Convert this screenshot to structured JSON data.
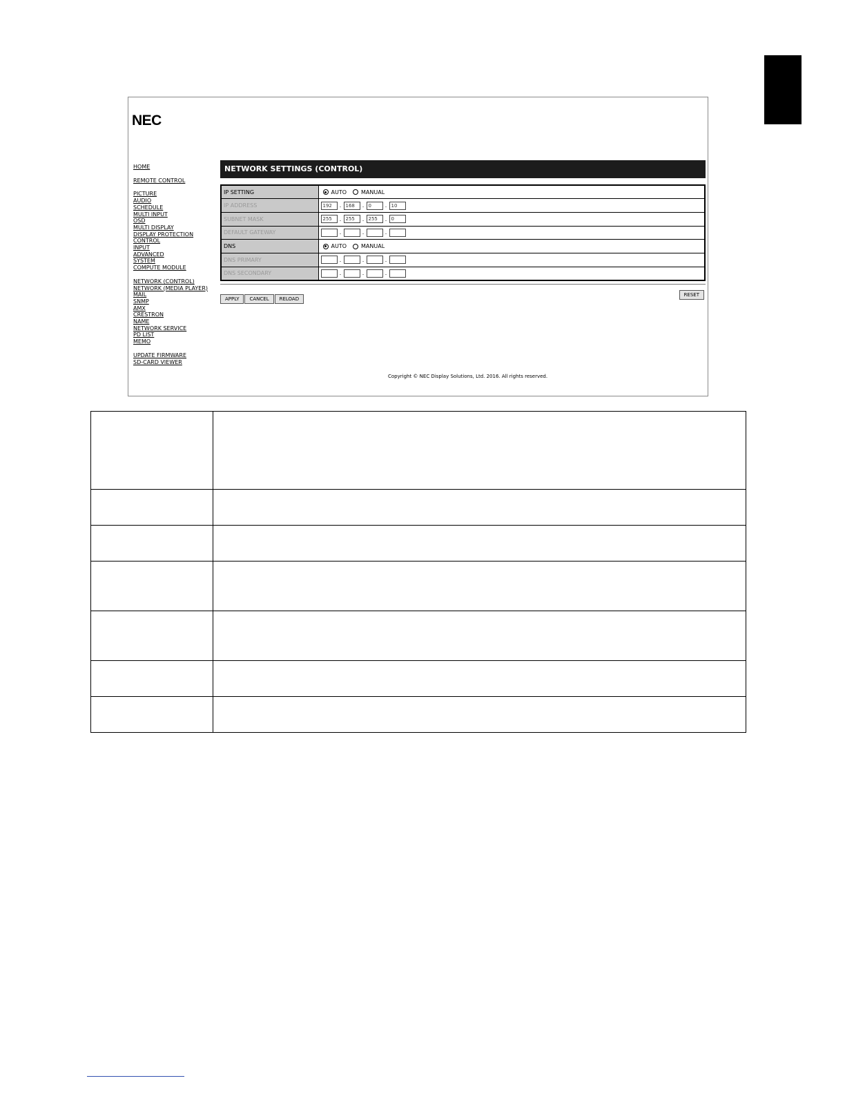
{
  "logo": "NEC",
  "nav": {
    "groups": [
      [
        "HOME"
      ],
      [
        "REMOTE CONTROL"
      ],
      [
        "PICTURE",
        "AUDIO",
        "SCHEDULE",
        "MULTI INPUT",
        "OSD",
        "MULTI DISPLAY",
        "DISPLAY PROTECTION",
        "CONTROL",
        "INPUT",
        "ADVANCED",
        "SYSTEM",
        "COMPUTE MODULE"
      ],
      [
        "NETWORK (CONTROL)",
        "NETWORK (MEDIA PLAYER)",
        "MAIL",
        "SNMP",
        "AMX",
        "CRESTRON",
        "NAME",
        "NETWORK SERVICE",
        "PD LIST",
        "MEMO"
      ],
      [
        "UPDATE FIRMWARE",
        "SD-CARD VIEWER"
      ]
    ]
  },
  "page_title": "NETWORK SETTINGS (CONTROL)",
  "settings": {
    "ip_setting": {
      "label": "IP SETTING",
      "auto": "AUTO",
      "manual": "MANUAL",
      "selected": "auto"
    },
    "ip_address": {
      "label": "IP ADDRESS",
      "octets": [
        "192",
        "168",
        "0",
        "10"
      ]
    },
    "subnet_mask": {
      "label": "SUBNET MASK",
      "octets": [
        "255",
        "255",
        "255",
        "0"
      ]
    },
    "default_gateway": {
      "label": "DEFAULT GATEWAY",
      "octets": [
        "",
        "",
        "",
        ""
      ]
    },
    "dns": {
      "label": "DNS",
      "auto": "AUTO",
      "manual": "MANUAL",
      "selected": "auto"
    },
    "dns_primary": {
      "label": "DNS PRIMARY",
      "octets": [
        "",
        "",
        "",
        ""
      ]
    },
    "dns_secondary": {
      "label": "DNS SECONDARY",
      "octets": [
        "",
        "",
        "",
        ""
      ]
    }
  },
  "buttons": {
    "apply": "APPLY",
    "cancel": "CANCEL",
    "reload": "RELOAD",
    "reset": "RESET"
  },
  "copyright": "Copyright © NEC Display Solutions, Ltd. 2016. All rights reserved.",
  "description_rows": 7
}
